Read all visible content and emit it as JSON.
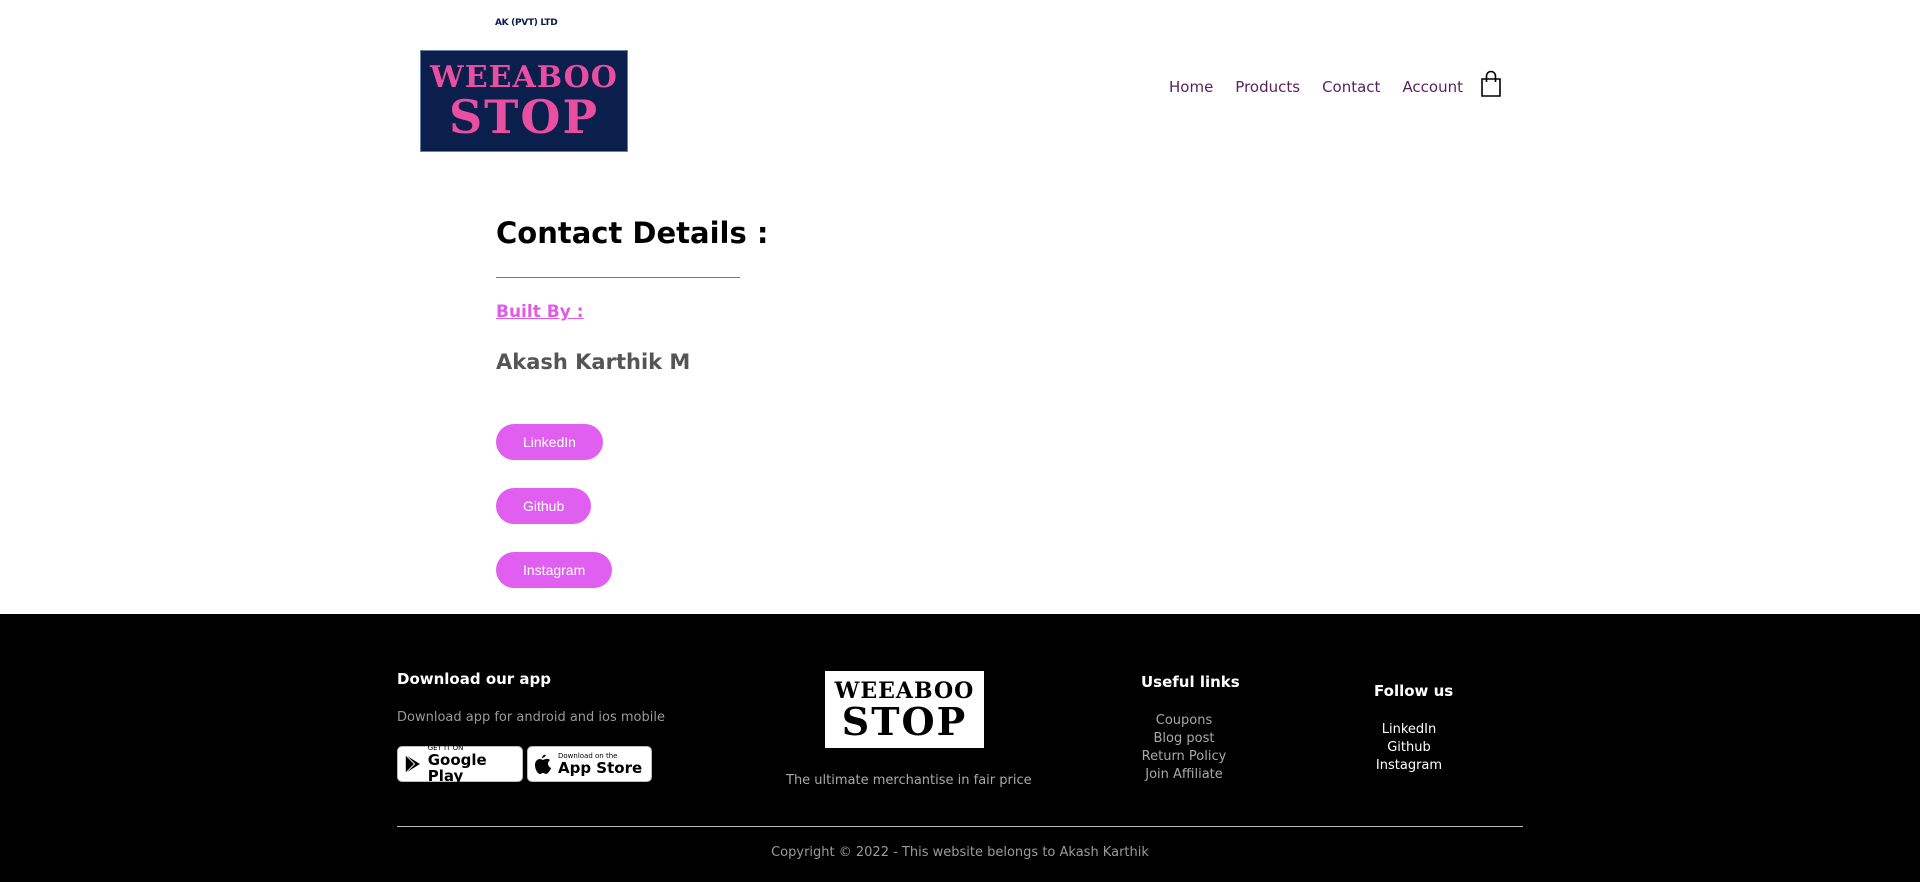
{
  "header": {
    "company_tag": "AK (PVT) LTD",
    "logo_line1": "WEEABOO",
    "logo_line2": "STOP",
    "nav": [
      "Home",
      "Products",
      "Contact",
      "Account"
    ],
    "cart_icon": "shopping-bag-icon"
  },
  "main": {
    "title": "Contact Details :",
    "built_by_label": "Built By :",
    "author": "Akash Karthik M",
    "buttons": [
      "LinkedIn",
      "Github",
      "Instagram"
    ]
  },
  "footer": {
    "download": {
      "heading": "Download our app",
      "text": "Download app for android and ios mobile",
      "google_small": "GET IT ON",
      "google_big": "Google Play",
      "apple_small": "Download on the",
      "apple_big": "App Store"
    },
    "brand": {
      "logo_line1": "WEEABOO",
      "logo_line2": "STOP",
      "tagline": "The ultimate merchantise in fair price"
    },
    "useful_links": {
      "heading": "Useful links",
      "items": [
        "Coupons",
        "Blog post",
        "Return Policy",
        "Join Affiliate"
      ]
    },
    "follow_us": {
      "heading": "Follow us",
      "items": [
        "LinkedIn",
        "Github",
        "Instagram"
      ]
    },
    "copyright": "Copyright © 2022 - This website belongs to Akash Karthik"
  },
  "colors": {
    "accent_pink": "#e15ff0",
    "logo_navy": "#0b1f4d",
    "logo_pink": "#ea4ea1",
    "nav_text": "#5a1f5a",
    "footer_bg": "#000000"
  }
}
